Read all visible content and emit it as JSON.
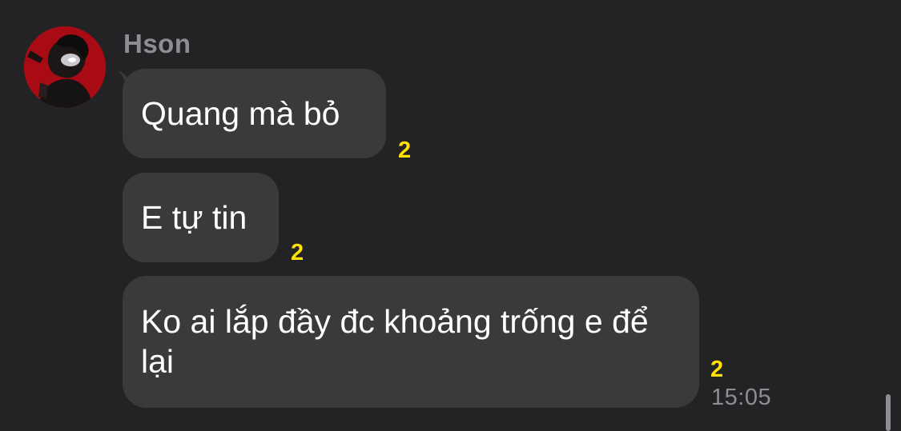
{
  "conversation": {
    "sender_name": "Hson",
    "messages": [
      {
        "text": "Quang mà bỏ",
        "reaction_count": "2"
      },
      {
        "text": "E tự tin",
        "reaction_count": "2"
      },
      {
        "text": "Ko ai lắp đầy đc khoảng trống e để lại",
        "reaction_count": "2"
      }
    ],
    "last_timestamp": "15:05"
  },
  "colors": {
    "background": "#232325",
    "bubble": "#3a3a3c",
    "message_text": "#ffffff",
    "sender_text": "#8e8e92",
    "reaction_count": "#ffe100"
  },
  "icons": {
    "avatar": "profile-photo"
  }
}
